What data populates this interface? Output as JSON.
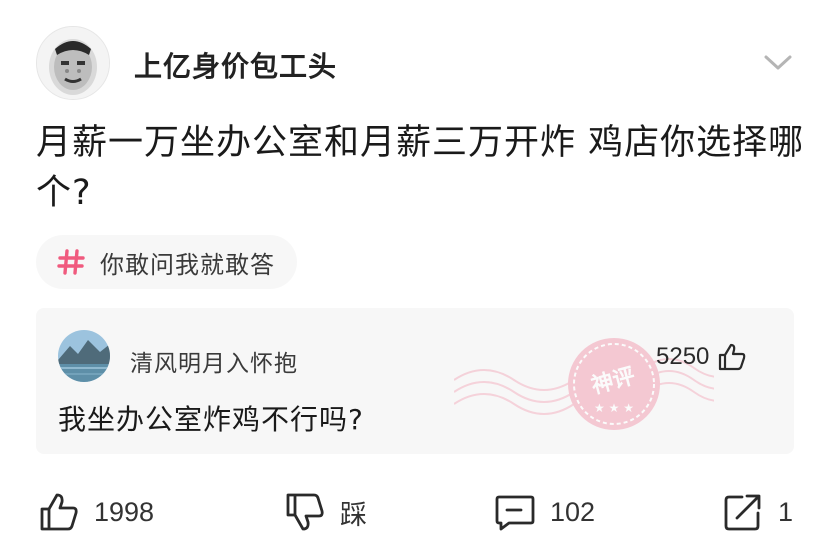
{
  "post": {
    "author": "上亿身价包工头",
    "text": "月薪一万坐办公室和月薪三万开炸 鸡店你选择哪个?",
    "topic": "你敢问我就敢答"
  },
  "hot_comment": {
    "author": "清风明月入怀抱",
    "like_count": "5250",
    "text": "我坐办公室炸鸡不行吗?",
    "badge": "神评"
  },
  "actions": {
    "like_count": "1998",
    "dislike_label": "踩",
    "comment_count": "102",
    "share_count": "1"
  },
  "icons": {
    "avatar": "meme-face-avatar",
    "more": "chevron-down-icon",
    "topic": "hash-icon",
    "like": "thumbs-up-icon",
    "dislike": "thumbs-down-icon",
    "comment": "comment-bubble-icon",
    "share": "share-arrow-icon",
    "badge": "god-comment-stamp"
  },
  "colors": {
    "topic_hash": "#f05a7e",
    "stamp": "#f2a3b5",
    "card_bg": "#f7f7f7"
  }
}
